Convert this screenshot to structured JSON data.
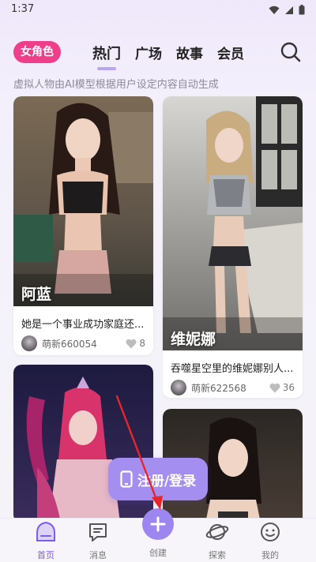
{
  "status_bar": {
    "time": "1:37"
  },
  "header": {
    "role_pill": "女角色",
    "tabs": [
      {
        "label": "热门",
        "active": true
      },
      {
        "label": "广场",
        "active": false
      },
      {
        "label": "故事",
        "active": false
      },
      {
        "label": "会员",
        "active": false
      }
    ],
    "subtitle": "虚拟人物由AI模型根据用户设定内容自动生成"
  },
  "cards": [
    {
      "name": "阿蓝",
      "desc": "她是一个事业成功家庭还...",
      "author": "萌新660054",
      "likes": "8"
    },
    {
      "name": "维妮娜",
      "desc": "吞噬星空里的维妮娜别人...",
      "author": "萌新622568",
      "likes": "36"
    }
  ],
  "register_button": {
    "label": "注册/登录"
  },
  "bottom_nav": {
    "items": [
      {
        "label": "首页",
        "icon": "home-icon"
      },
      {
        "label": "消息",
        "icon": "message-icon"
      },
      {
        "label": "创建",
        "icon": "plus-icon"
      },
      {
        "label": "探索",
        "icon": "planet-icon"
      },
      {
        "label": "我的",
        "icon": "smiley-icon"
      }
    ]
  },
  "colors": {
    "accent": "#9d86ef",
    "pill": "#f03f8a",
    "arrow": "#e8252a"
  }
}
